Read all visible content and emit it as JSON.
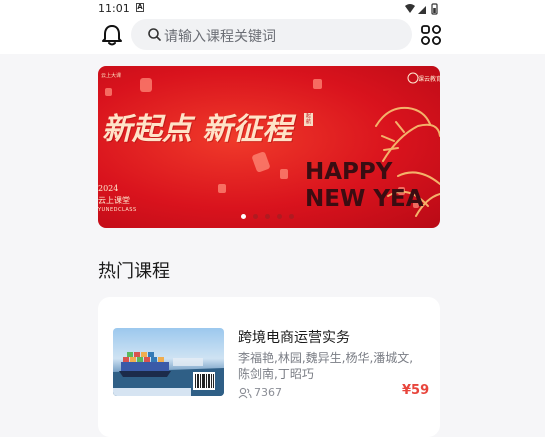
{
  "status_bar": {
    "time": "11:01",
    "notification_badge": "A"
  },
  "header": {
    "search_placeholder": "请输入课程关键词",
    "icons": [
      "bell-icon",
      "search-icon",
      "grid-menu-icon"
    ]
  },
  "banner": {
    "small_title": "云上大课",
    "logo_text": "课云教育",
    "calligraphy": "新起点 新征程",
    "seal": "起航",
    "year": "2024",
    "cn_name": "云上课堂",
    "en_name": "YUNEDCLASS",
    "happy": "HAPPY",
    "new_year": "NEW YEA",
    "slides_count": 5,
    "active_slide": 1,
    "colors": {
      "primary": "#d9131d",
      "text_gold": "#ffe3c8",
      "dark": "#3a0d12"
    }
  },
  "section": {
    "title": "热门课程"
  },
  "courses": [
    {
      "title": "跨境电商运营实务",
      "teachers": "李福艳,林园,魏异生,杨华,潘城文,陈剑南,丁昭巧",
      "learners": "7367",
      "price": "¥59"
    }
  ],
  "colors": {
    "accent_price": "#e8453c",
    "page_bg": "#f6f6f8"
  }
}
